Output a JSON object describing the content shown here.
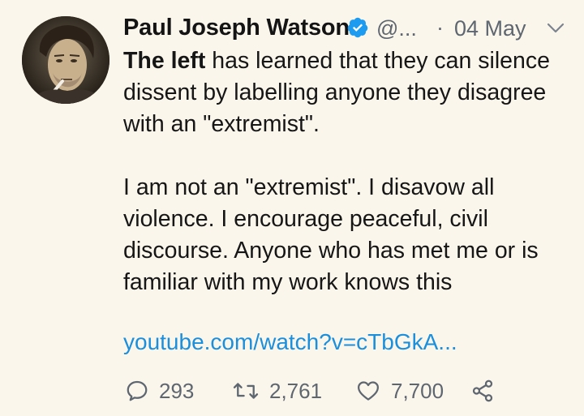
{
  "tweet": {
    "display_name": "Paul Joseph Watson",
    "handle": "@...",
    "separator": "·",
    "date": "04 May",
    "body": {
      "lead_bold": "The left",
      "lead_rest": " has learned that they can silence dissent by labelling anyone they disagree with an \"extremist\".",
      "paragraph2": "I am not an \"extremist\". I disavow all violence. I encourage peaceful, civil discourse. Anyone who has met me or is familiar with my work knows this"
    },
    "link": "youtube.com/watch?v=cTbGkA...",
    "actions": {
      "reply_count": "293",
      "retweet_count": "2,761",
      "like_count": "7,700"
    }
  },
  "colors": {
    "background": "#fbf6ec",
    "text": "#161616",
    "muted": "#5e6670",
    "link": "#1b8fdc",
    "verified": "#1d9bf0"
  },
  "icons": {
    "verified": "verified-badge-icon",
    "menu": "chevron-down-icon",
    "reply": "reply-icon",
    "retweet": "retweet-icon",
    "like": "heart-icon",
    "share": "share-icon"
  }
}
